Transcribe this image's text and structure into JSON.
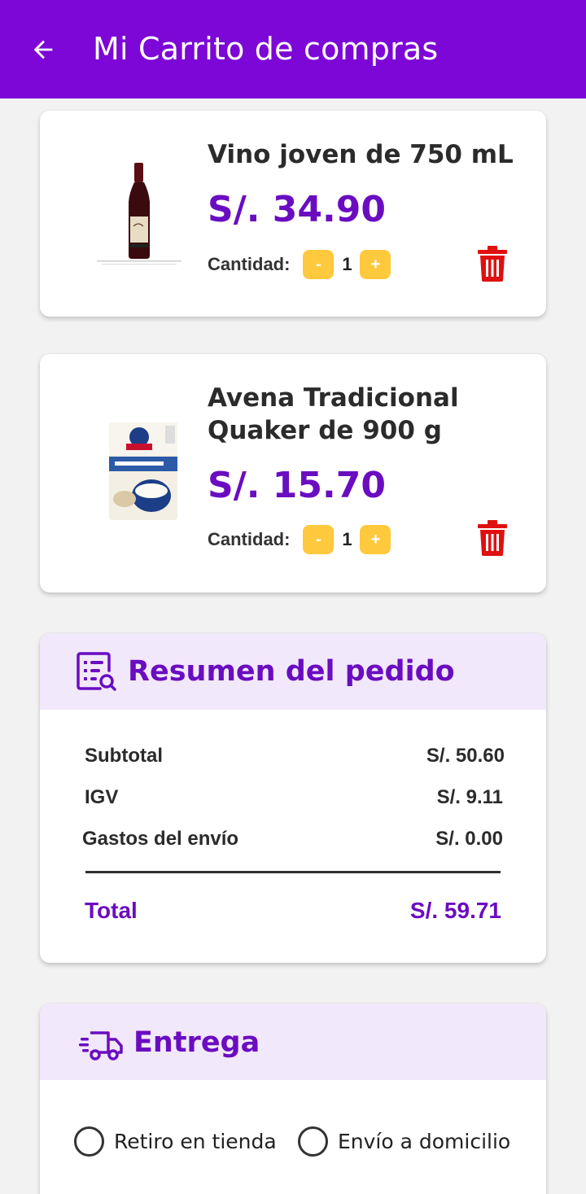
{
  "appbar": {
    "title": "Mi Carrito de compras",
    "back_icon": "arrow-left-icon"
  },
  "cart": {
    "qty_label": "Cantidad:",
    "minus_label": "-",
    "plus_label": "+",
    "items": [
      {
        "name_line1": "Vino joven de 750 mL",
        "name_line2": "",
        "price": "S/. 34.90",
        "quantity": "1",
        "image_icon": "wine-bottle-image"
      },
      {
        "name_line1": "Avena Tradicional",
        "name_line2": "Quaker de 900 g",
        "price": "S/. 15.70",
        "quantity": "1",
        "image_icon": "oats-bag-image"
      }
    ]
  },
  "summary": {
    "title": "Resumen del pedido",
    "icon": "receipt-search-icon",
    "rows": [
      {
        "label": "Subtotal",
        "value": "S/. 50.60"
      },
      {
        "label": "IGV",
        "value": "S/. 9.11"
      },
      {
        "label": "Gastos del envío",
        "value": "S/. 0.00"
      }
    ],
    "total_label": "Total",
    "total_value": "S/. 59.71"
  },
  "delivery": {
    "title": "Entrega",
    "icon": "delivery-truck-icon",
    "options": [
      "Retiro en tienda",
      "Envío a domicilio"
    ]
  },
  "colors": {
    "primary": "#7c07d6",
    "accent_text": "#6a0dc1",
    "qty_button": "#ffc93e",
    "delete": "#e01010",
    "section_header": "#f2e8fb"
  }
}
